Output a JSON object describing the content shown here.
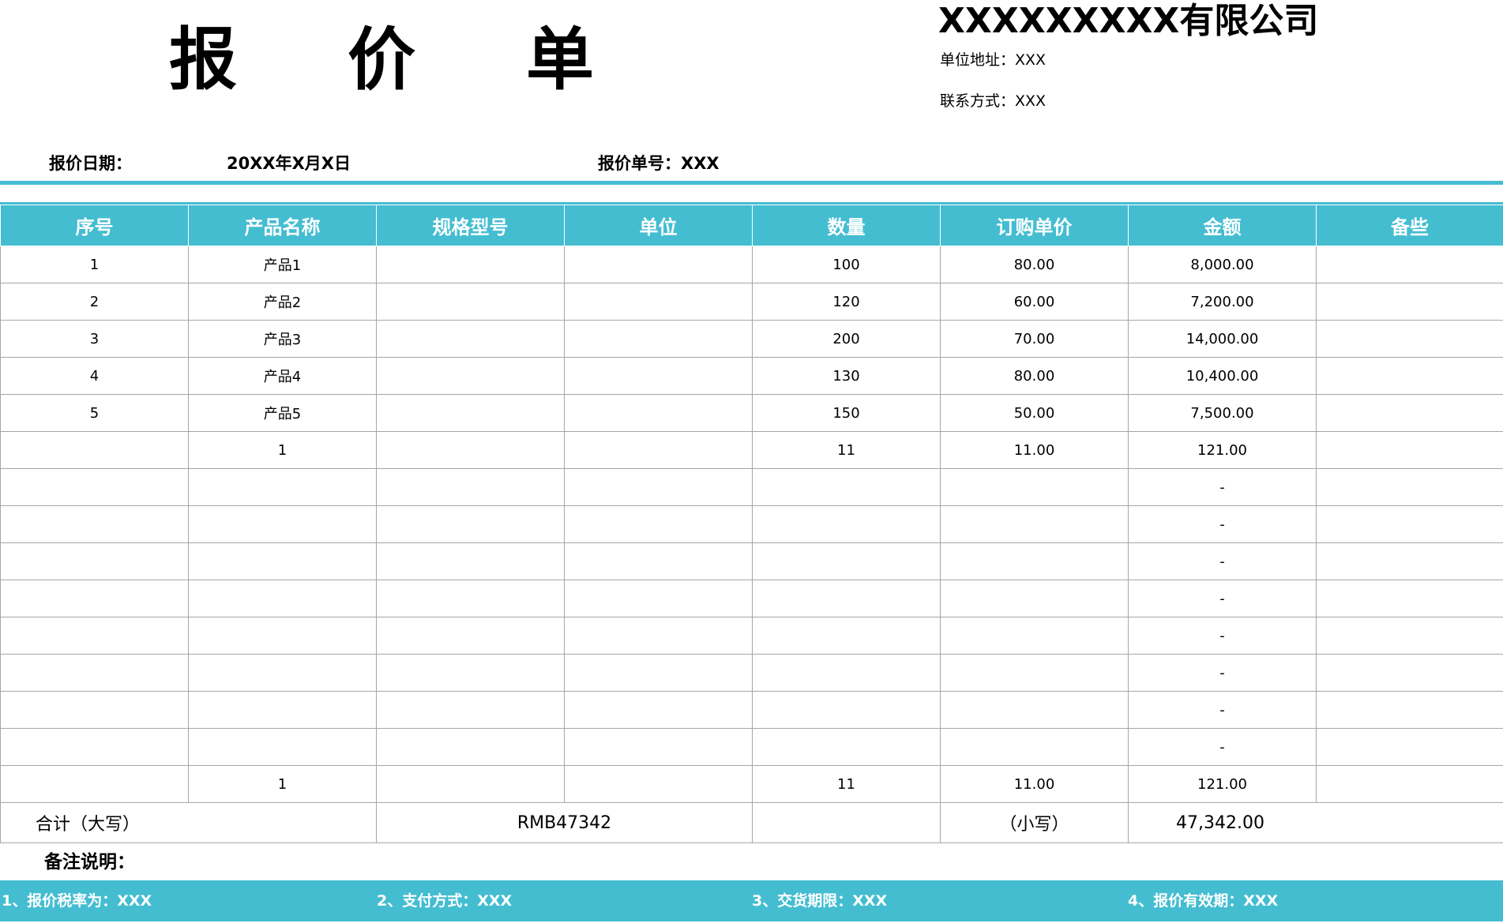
{
  "title_chars": [
    "报",
    "价",
    "单"
  ],
  "company": {
    "name": "XXXXXXXXX有限公司",
    "address": "单位地址：XXX",
    "contact": "联系方式：XXX"
  },
  "meta": {
    "date_label": "报价日期：",
    "date_value": "20XX年X月X日",
    "quote_no": "报价单号：XXX"
  },
  "table": {
    "headers": [
      "序号",
      "产品名称",
      "规格型号",
      "单位",
      "数量",
      "订购单价",
      "金额",
      "备些"
    ],
    "rows": [
      [
        "1",
        "产品1",
        "",
        "",
        "100",
        "80.00",
        "8,000.00",
        ""
      ],
      [
        "2",
        "产品2",
        "",
        "",
        "120",
        "60.00",
        "7,200.00",
        ""
      ],
      [
        "3",
        "产品3",
        "",
        "",
        "200",
        "70.00",
        "14,000.00",
        ""
      ],
      [
        "4",
        "产品4",
        "",
        "",
        "130",
        "80.00",
        "10,400.00",
        ""
      ],
      [
        "5",
        "产品5",
        "",
        "",
        "150",
        "50.00",
        "7,500.00",
        ""
      ],
      [
        "",
        "1",
        "",
        "",
        "11",
        "11.00",
        "121.00",
        ""
      ],
      [
        "",
        "",
        "",
        "",
        "",
        "",
        "-",
        ""
      ],
      [
        "",
        "",
        "",
        "",
        "",
        "",
        "-",
        ""
      ],
      [
        "",
        "",
        "",
        "",
        "",
        "",
        "-",
        ""
      ],
      [
        "",
        "",
        "",
        "",
        "",
        "",
        "-",
        ""
      ],
      [
        "",
        "",
        "",
        "",
        "",
        "",
        "-",
        ""
      ],
      [
        "",
        "",
        "",
        "",
        "",
        "",
        "-",
        ""
      ],
      [
        "",
        "",
        "",
        "",
        "",
        "",
        "-",
        ""
      ],
      [
        "",
        "",
        "",
        "",
        "",
        "",
        "-",
        ""
      ],
      [
        "",
        "1",
        "",
        "",
        "11",
        "11.00",
        "121.00",
        ""
      ]
    ],
    "total": {
      "label_upper": "合计（大写）",
      "value_upper": "RMB47342",
      "label_lower": "（小写）",
      "value_lower": "47,342.00"
    }
  },
  "remarks": {
    "title": "备注说明：",
    "items": [
      "1、报价税率为：XXX",
      "2、支付方式：XXX",
      "3、交货期限：XXX",
      "4、报价有效期：XXX"
    ]
  },
  "colors": {
    "accent": "#44bdd1",
    "grid_line": "#a6a6a6"
  }
}
